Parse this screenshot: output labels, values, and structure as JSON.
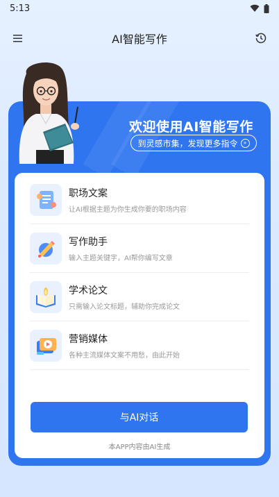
{
  "status": {
    "time": "5:13"
  },
  "header": {
    "title": "AI智能写作",
    "menu_icon": "menu-icon",
    "history_icon": "history-icon"
  },
  "hero": {
    "welcome": "欢迎使用AI智能写作",
    "link_label": "到灵感市集，发现更多指令"
  },
  "features": [
    {
      "title": "职场文案",
      "desc": "让AI根据主题为你生成你要的职场内容",
      "icon": "document-icon"
    },
    {
      "title": "写作助手",
      "desc": "输入主题关键字，AI帮你编写文章",
      "icon": "pencil-icon"
    },
    {
      "title": "学术论文",
      "desc": "只需输入论文标题，辅助你完成论文",
      "icon": "book-icon"
    },
    {
      "title": "营销媒体",
      "desc": "各种主流媒体文案不用愁，由此开始",
      "icon": "media-icon"
    }
  ],
  "cta": {
    "label": "与AI对话"
  },
  "footer": {
    "note": "本APP内容由AI生成"
  },
  "colors": {
    "primary": "#2f75f0",
    "background": "#dceaff"
  }
}
